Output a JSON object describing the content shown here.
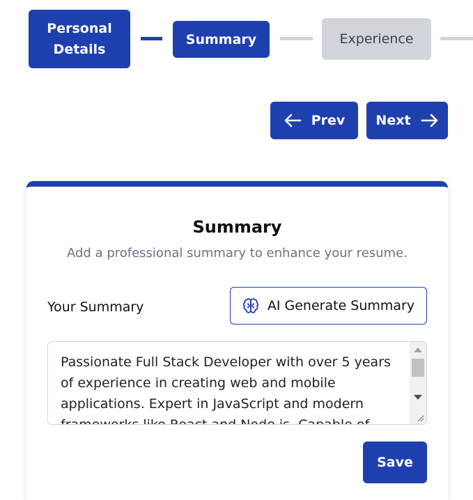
{
  "stepper": {
    "steps": [
      {
        "label_line1": "Personal",
        "label_line2": "Details",
        "state": "done"
      },
      {
        "label": "Summary",
        "state": "active"
      },
      {
        "label": "Experience",
        "state": "pending"
      }
    ]
  },
  "navigation": {
    "prev_label": "Prev",
    "next_label": "Next",
    "prev_icon": "arrow-left-icon",
    "next_icon": "arrow-right-icon"
  },
  "card": {
    "title": "Summary",
    "subtitle": "Add a professional summary to enhance your resume.",
    "field_label": "Your Summary",
    "ai_button_label": "AI Generate Summary",
    "ai_button_icon": "brain-icon",
    "summary_text": "Passionate Full Stack Developer with over 5 years of experience in creating web and mobile applications. Expert in JavaScript and modern frameworks like React and Node.js. Capable of designing innovative",
    "save_label": "Save"
  },
  "colors": {
    "primary": "#1e40af",
    "inactive": "#d1d5db",
    "muted_text": "#6b7280"
  }
}
